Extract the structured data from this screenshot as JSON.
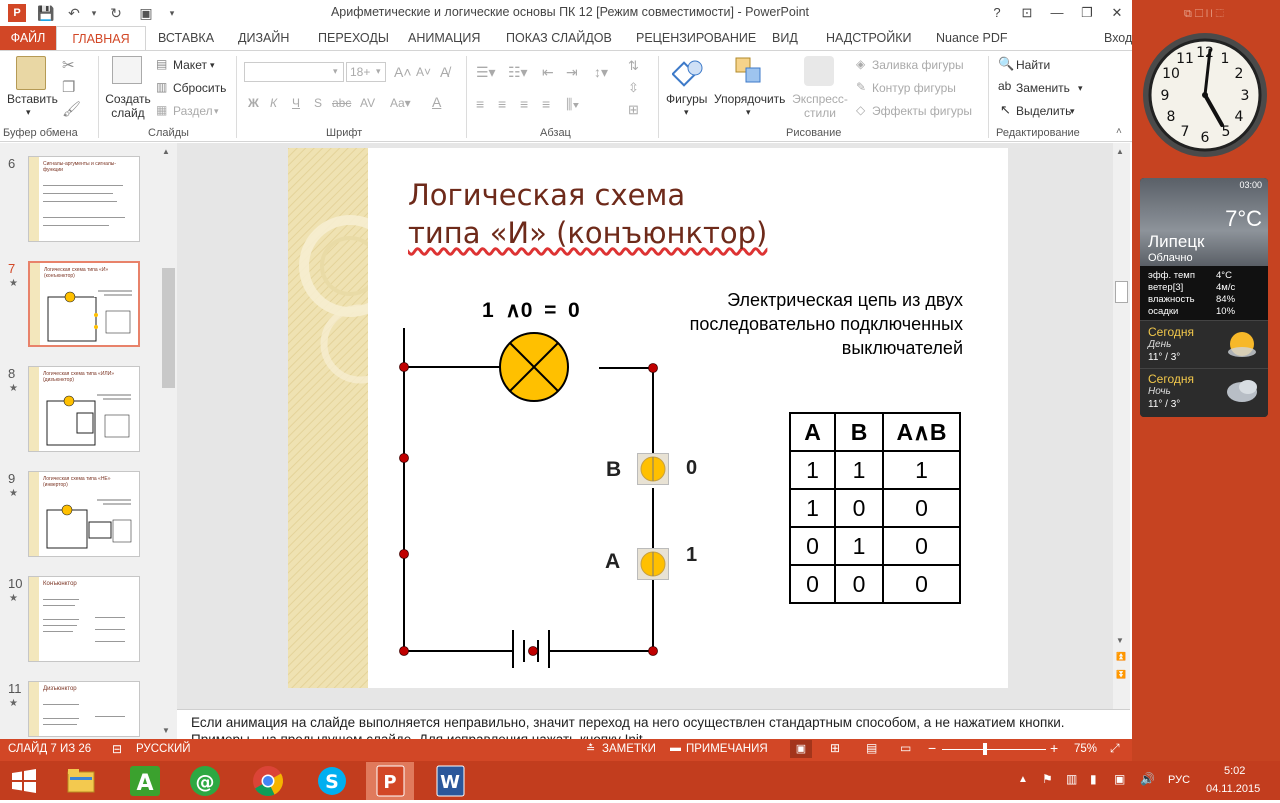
{
  "window": {
    "title": "Арифметические и логические основы ПК 12 [Режим совместимости] - PowerPoint",
    "help": "?",
    "user": "Вход"
  },
  "tabs": [
    "ФАЙЛ",
    "ГЛАВНАЯ",
    "ВСТАВКА",
    "ДИЗАЙН",
    "ПЕРЕХОДЫ",
    "АНИМАЦИЯ",
    "ПОКАЗ СЛАЙДОВ",
    "РЕЦЕНЗИРОВАНИЕ",
    "ВИД",
    "НАДСТРОЙКИ",
    "Nuance PDF"
  ],
  "ribbon": {
    "groups": [
      "Буфер обмена",
      "Слайды",
      "Шрифт",
      "Абзац",
      "Рисование",
      "Редактирование"
    ],
    "paste": "Вставить",
    "new_slide": "Создать слайд",
    "layout": "Макет",
    "reset": "Сбросить",
    "section": "Раздел",
    "font_size": "18+",
    "bold": "Ж",
    "italic": "К",
    "underline": "Ч",
    "strike": "S",
    "shapes": "Фигуры",
    "arrange": "Упорядочить",
    "quick_styles": "Экспресс-стили",
    "shape_fill": "Заливка фигуры",
    "shape_outline": "Контур фигуры",
    "shape_effects": "Эффекты фигуры",
    "find": "Найти",
    "replace": "Заменить",
    "select": "Выделить"
  },
  "thumbnails": [
    {
      "num": "6",
      "star": "",
      "title": "Сигналы-аргументы и сигналы-функции"
    },
    {
      "num": "7",
      "star": "★",
      "title": "Логическая схема типа «И» (конъюнктор)"
    },
    {
      "num": "8",
      "star": "★",
      "title": "Логическая схема типа «ИЛИ» (дизъюнктор)"
    },
    {
      "num": "9",
      "star": "★",
      "title": "Логическая схема типа «НЕ» (инвертор)"
    },
    {
      "num": "10",
      "star": "★",
      "title": "Конъюнктор"
    },
    {
      "num": "11",
      "star": "★",
      "title": "Дизъюнктор"
    }
  ],
  "slide": {
    "title_line1": "Логическая схема",
    "title_line2": "типа «И» (конъюнктор)",
    "expression": "1  ∧0  =  0",
    "caption_line1": "Электрическая цепь из двух",
    "caption_line2": "последовательно подключенных",
    "caption_line3": "выключателей",
    "switch_b_label": "В",
    "switch_b_value": "0",
    "switch_a_label": "А",
    "switch_a_value": "1",
    "truth_table": {
      "headers": [
        "А",
        "В",
        "А∧В"
      ],
      "rows": [
        [
          "1",
          "1",
          "1"
        ],
        [
          "1",
          "0",
          "0"
        ],
        [
          "0",
          "1",
          "0"
        ],
        [
          "0",
          "0",
          "0"
        ]
      ]
    }
  },
  "notes": "Если анимация на слайде выполняется неправильно, значит переход на него осуществлен стандартным способом, а не нажатием кнопки. Примеры - на предыдущем слайде. Для исправления нажать кнопку Init",
  "status": {
    "slide": "СЛАЙД 7 ИЗ 26",
    "language": "РУССКИЙ",
    "notes_btn": "ЗАМЕТКИ",
    "comments_btn": "ПРИМЕЧАНИЯ",
    "zoom": "75%"
  },
  "tray": {
    "lang": "РУС",
    "time": "5:02",
    "date": "04.11.2015"
  },
  "weather": {
    "time": "03:00",
    "temp": "7°C",
    "city": "Липецк",
    "condition": "Облачно",
    "rows": [
      [
        "эфф. темп",
        "4°C"
      ],
      [
        "ветер[3]",
        "4м/с"
      ],
      [
        "влажность",
        "84%"
      ],
      [
        "осадки",
        "10%"
      ]
    ],
    "today_label": "Сегодня",
    "day_label": "День",
    "day_temps": "11° / 3°",
    "night_label": "Ночь",
    "night_temps": "11° / 3°"
  },
  "colors": {
    "accent": "#d24726",
    "title": "#6e2a1a",
    "lamp": "#ffc000",
    "desktop": "#c64321"
  }
}
